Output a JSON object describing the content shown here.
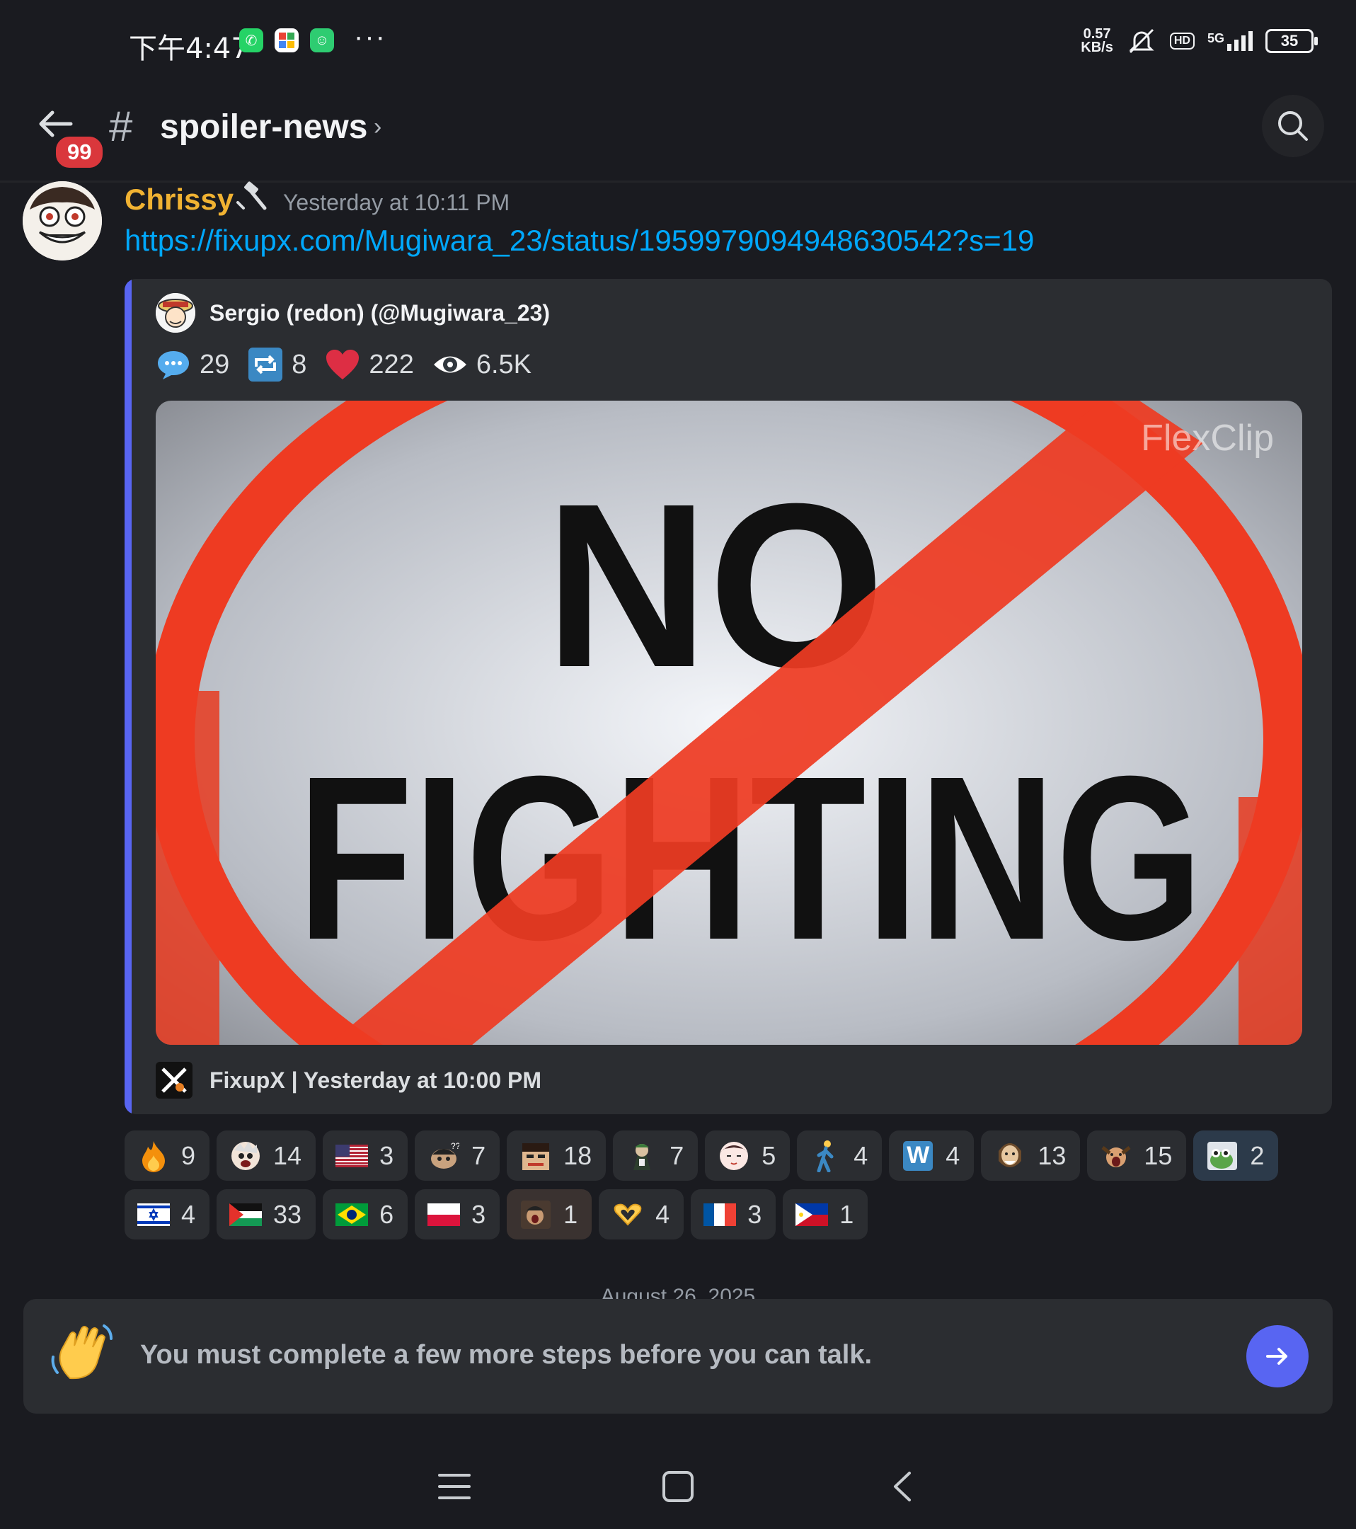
{
  "status_bar": {
    "time": "下午4:47",
    "net_speed_value": "0.57",
    "net_speed_unit": "KB/s",
    "hd_label": "HD",
    "network_type": "5G",
    "battery": "35"
  },
  "header": {
    "unread_badge": "99",
    "hash": "#",
    "channel_name": "spoiler-news",
    "chevron": "›"
  },
  "message": {
    "author": "Chrissy",
    "author_color": "#f0b232",
    "timestamp": "Yesterday at 10:11 PM",
    "link": "https://fixupx.com/Mugiwara_23/status/1959979094948630542?s=19"
  },
  "embed": {
    "author": "Sergio (redon) (@Mugiwara_23)",
    "stats": {
      "replies": "29",
      "retweets": "8",
      "likes": "222",
      "views": "6.5K"
    },
    "image": {
      "line1": "NO",
      "line2": "FIGHTING",
      "watermark": "FlexClip"
    },
    "footer": "FixupX | Yesterday at 10:00 PM"
  },
  "reactions": {
    "row1": [
      {
        "emoji": "fire-icon",
        "count": "9"
      },
      {
        "emoji": "custom-face-icon",
        "count": "14"
      },
      {
        "emoji": "flag-us",
        "count": "3"
      },
      {
        "emoji": "custom-confused-icon",
        "count": "7"
      },
      {
        "emoji": "custom-pirate-icon",
        "count": "18"
      },
      {
        "emoji": "custom-character-icon",
        "count": "7"
      },
      {
        "emoji": "custom-anime-face-icon",
        "count": "5"
      },
      {
        "emoji": "person-walking-icon",
        "count": "4"
      },
      {
        "emoji": "letter-w-icon",
        "count": "4"
      },
      {
        "emoji": "custom-bearded-icon",
        "count": "13"
      },
      {
        "emoji": "custom-shocked-icon",
        "count": "15"
      },
      {
        "emoji": "custom-frog-icon",
        "count": "2"
      }
    ],
    "row2": [
      {
        "emoji": "flag-israel",
        "count": "4"
      },
      {
        "emoji": "flag-palestine",
        "count": "33"
      },
      {
        "emoji": "flag-brazil",
        "count": "6"
      },
      {
        "emoji": "flag-poland",
        "count": "3"
      },
      {
        "emoji": "custom-gif-icon",
        "count": "1"
      },
      {
        "emoji": "heart-hands-icon",
        "count": "4"
      },
      {
        "emoji": "flag-france",
        "count": "3"
      },
      {
        "emoji": "flag-philippines",
        "count": "1"
      }
    ]
  },
  "date_divider": "August 26, 2025",
  "composer": {
    "notice": "You must complete a few more steps before you can talk."
  },
  "colors": {
    "background": "#1a1b20",
    "accent": "#5865f2",
    "link": "#00a8fc",
    "badge": "#da373c"
  }
}
